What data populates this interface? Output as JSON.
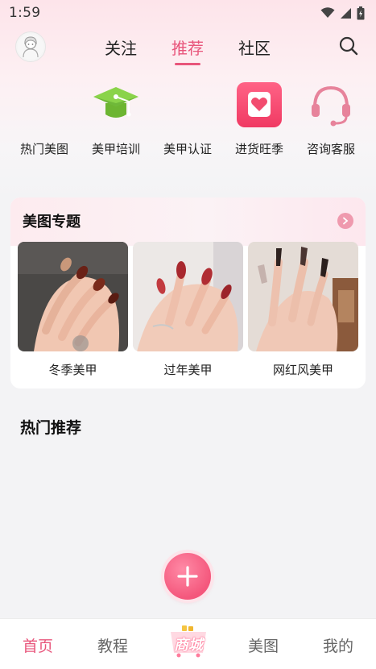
{
  "status_bar": {
    "time": "1:59"
  },
  "header": {
    "tabs": [
      {
        "label": "关注",
        "active": false
      },
      {
        "label": "推荐",
        "active": true
      },
      {
        "label": "社区",
        "active": false
      }
    ]
  },
  "categories": [
    {
      "label": "热门美图",
      "icon": "hot-image-icon"
    },
    {
      "label": "美甲培训",
      "icon": "graduation-cap-icon"
    },
    {
      "label": "美甲认证",
      "icon": "certification-icon"
    },
    {
      "label": "进货旺季",
      "icon": "heart-bag-icon"
    },
    {
      "label": "咨询客服",
      "icon": "headset-icon"
    }
  ],
  "topics": {
    "title": "美图专题",
    "items": [
      {
        "label": "冬季美甲"
      },
      {
        "label": "过年美甲"
      },
      {
        "label": "网红风美甲"
      }
    ]
  },
  "hot_section": {
    "title": "热门推荐"
  },
  "bottom_nav": {
    "items": [
      {
        "label": "首页",
        "active": true
      },
      {
        "label": "教程",
        "active": false
      },
      {
        "label": "商城",
        "active": false
      },
      {
        "label": "美图",
        "active": false
      },
      {
        "label": "我的",
        "active": false
      }
    ]
  },
  "colors": {
    "accent": "#e8557b",
    "cap_green": "#7bc93a",
    "heart_box": "#f24c6f",
    "headset": "#e7839b"
  }
}
